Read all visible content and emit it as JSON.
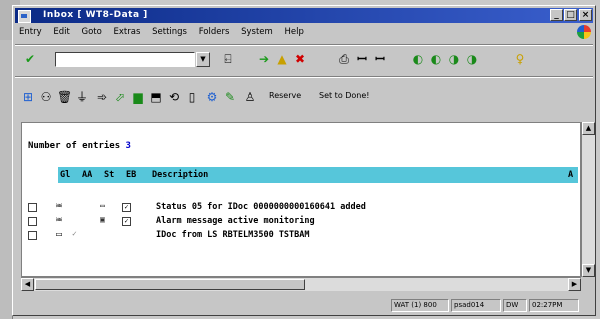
{
  "window": {
    "title": "Inbox   [ WT8-Data ]",
    "controls": {
      "minimize": "_",
      "maximize": "□",
      "close": "×"
    }
  },
  "menubar": {
    "items": [
      "Entry",
      "Edit",
      "Goto",
      "Extras",
      "Settings",
      "Folders",
      "System",
      "Help"
    ]
  },
  "toolbar1": {
    "command_field_value": ""
  },
  "toolbar2": {
    "reserve_label": "Reserve",
    "set_to_done_label": "Set to Done!"
  },
  "content": {
    "entries_label": "Number of entries",
    "entries_count": "3",
    "columns": [
      "Gl",
      "AA",
      "St",
      "EB",
      "Description",
      "A"
    ],
    "rows": [
      {
        "description": "Status 05 for IDoc 0000000000160641 added"
      },
      {
        "description": "Alarm message active monitoring"
      },
      {
        "description": "IDoc from LS RBTELM3500 TSTBAM"
      }
    ]
  },
  "statusbar": {
    "fields": [
      "WAT (1) 800",
      "psad014",
      "DW",
      "02:27PM"
    ]
  },
  "colors": {
    "title_gradient_start": "#0b2a86",
    "header_row_bg": "#56c6da",
    "entries_count_color": "#0000cc",
    "window_bg": "#c6c6c6"
  }
}
